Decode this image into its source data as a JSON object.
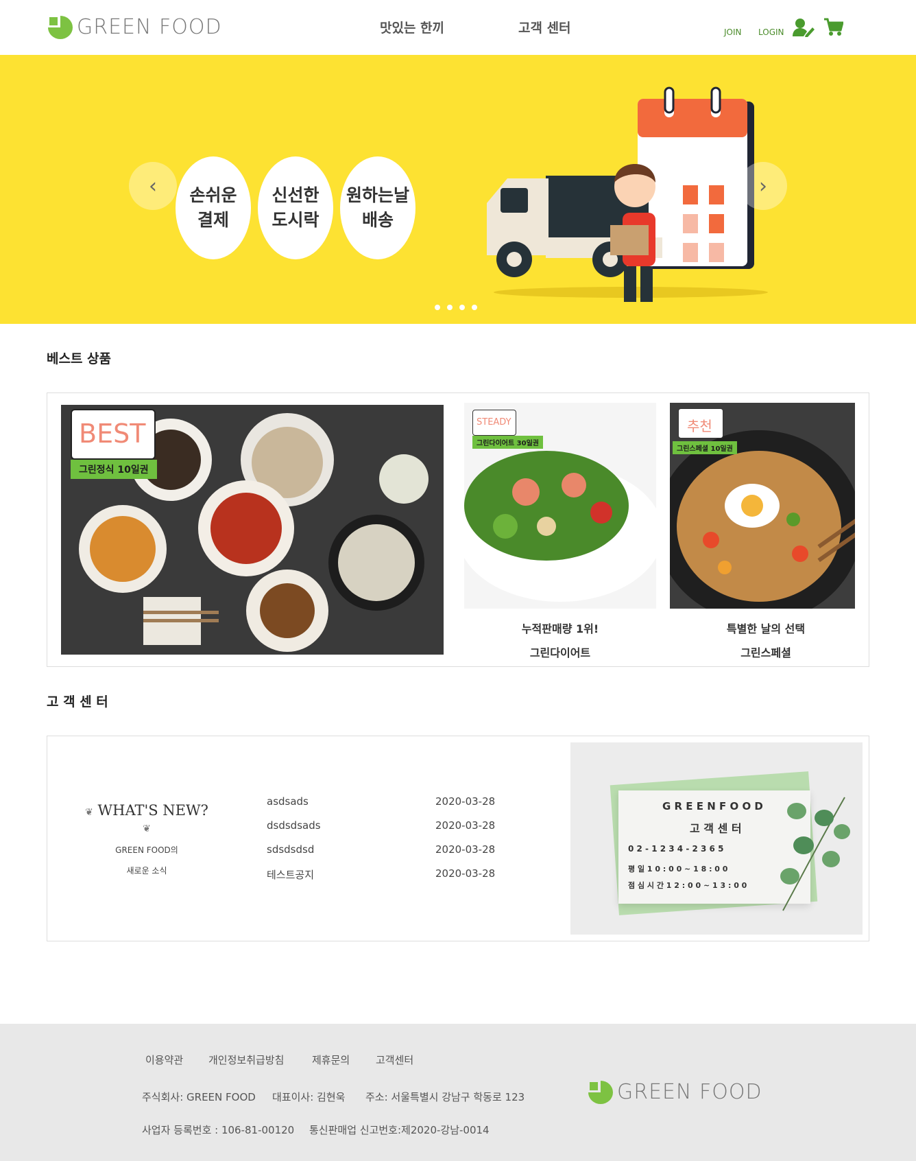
{
  "header": {
    "logo_text": "GREEN FOOD",
    "nav": [
      "맛있는 한끼",
      "고객 센터"
    ],
    "join": "JOIN",
    "login": "LOGIN",
    "icons": [
      "user-edit-icon",
      "cart-icon"
    ]
  },
  "banner": {
    "bubbles": [
      {
        "line1": "손쉬운",
        "line2": "결제"
      },
      {
        "line1": "신선한",
        "line2": "도시락"
      },
      {
        "line1": "원하는날",
        "line2": "배송"
      }
    ],
    "prev_icon": "chevron-left-icon",
    "next_icon": "chevron-right-icon",
    "slide_count": 4
  },
  "best": {
    "title": "베스트 상품",
    "main": {
      "tag": "BEST",
      "ribbon": "그린정식 10일권"
    },
    "items": [
      {
        "tag": "STEADY",
        "ribbon": "그린다이어트 30일권",
        "caption1": "누적판매량 1위!",
        "caption2": "그린다이어트"
      },
      {
        "tag": "추천",
        "ribbon": "그린스페셜 10일권",
        "caption1": "특별한 날의 선택",
        "caption2": "그린스페셜"
      }
    ]
  },
  "cs": {
    "title": "고 객 센 터",
    "news": {
      "title": "WHAT'S NEW?",
      "sub1": "GREEN FOOD의",
      "sub2": "새로운 소식"
    },
    "notices": [
      {
        "title": "asdsads",
        "date": "2020-03-28"
      },
      {
        "title": "dsdsdsads",
        "date": "2020-03-28"
      },
      {
        "title": "sdsdsdsd",
        "date": "2020-03-28"
      },
      {
        "title": "테스트공지",
        "date": "2020-03-28"
      }
    ],
    "card": {
      "brand": "G R E E N   F O O D",
      "title": "고 객 센 터",
      "phone": "0 2 - 1 2 3 4 - 2 3 6 5",
      "weekday": "평 일   1 0 : 0 0 ~ 1 8 : 0 0",
      "lunch": "점 심 시 간   1 2 : 0 0 ~ 1 3 : 0 0"
    }
  },
  "footer": {
    "links": [
      "이용약관",
      "개인정보취급방침",
      "제휴문의",
      "고객센터"
    ],
    "company": "주식회사: GREEN FOOD",
    "ceo": "대표이사: 김현욱",
    "address": "주소: 서울특별시 강남구 학동로 123",
    "biz_no": "사업자 등록번호 : 106-81-00120",
    "sales_no": "통신판매업 신고번호:제2020-강남-0014",
    "logo_text": "GREEN FOOD"
  },
  "colors": {
    "brand_green": "#7dc242",
    "banner_yellow": "#fde232",
    "footer_bg": "#e8e8e8"
  }
}
